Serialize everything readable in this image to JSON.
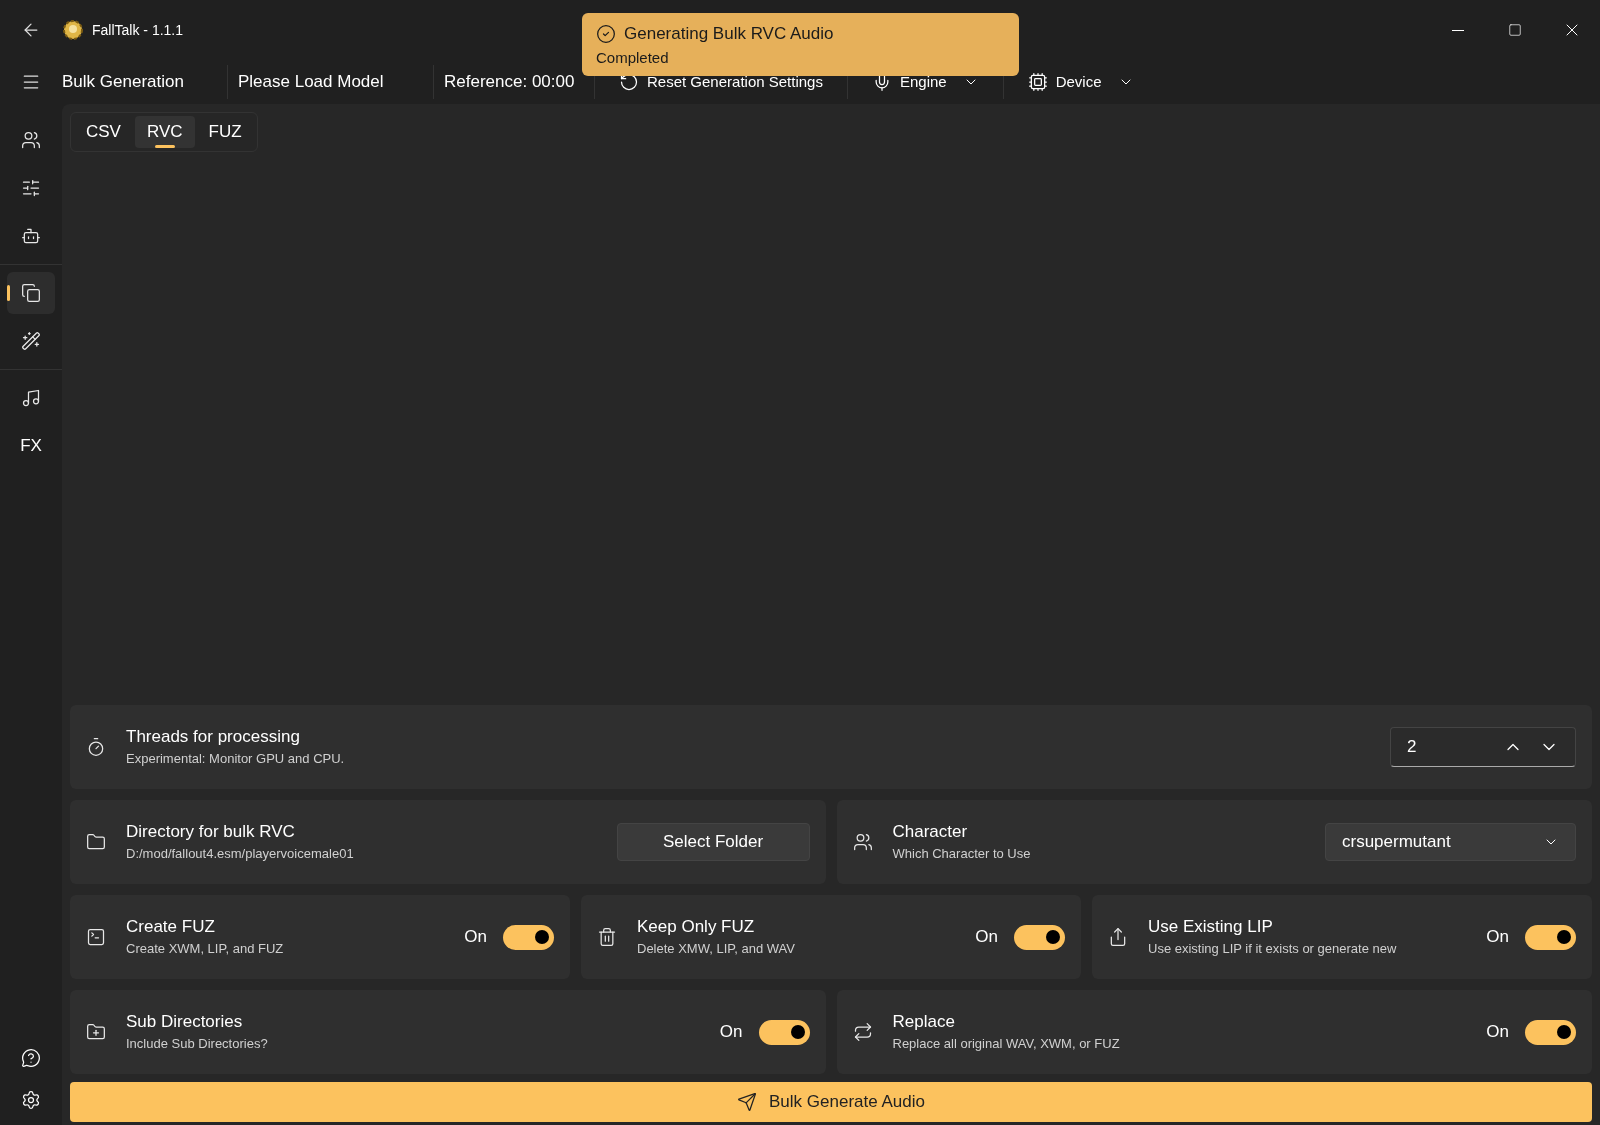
{
  "window": {
    "title": "FallTalk - 1.1.1"
  },
  "toast": {
    "title": "Generating Bulk RVC Audio",
    "message": "Completed"
  },
  "toolbar": {
    "page_title": "Bulk Generation",
    "model": "Please Load Model",
    "reference": "Reference: 00:00",
    "reset": "Reset Generation Settings",
    "engine": "Engine",
    "device": "Device"
  },
  "sidebar": {
    "items": [
      {
        "kind": "icon",
        "selected": false
      },
      {
        "kind": "icon",
        "selected": false
      },
      {
        "kind": "icon",
        "selected": false
      },
      {
        "kind": "icon",
        "selected": true
      },
      {
        "kind": "icon",
        "selected": false
      },
      {
        "kind": "icon",
        "selected": false
      },
      {
        "kind": "text",
        "label": "FX",
        "selected": false
      }
    ]
  },
  "tabs": [
    {
      "label": "CSV",
      "selected": false
    },
    {
      "label": "RVC",
      "selected": true
    },
    {
      "label": "FUZ",
      "selected": false
    }
  ],
  "threads": {
    "title": "Threads for processing",
    "subtitle": "Experimental: Monitor GPU and CPU.",
    "value": "2"
  },
  "directory": {
    "title": "Directory for bulk RVC",
    "subtitle": "D:/mod/fallout4.esm/playervoicemale01",
    "button": "Select Folder"
  },
  "character": {
    "title": "Character",
    "subtitle": "Which Character to Use",
    "value": "crsupermutant"
  },
  "toggles_row_1": [
    {
      "title": "Create FUZ",
      "subtitle": "Create XWM, LIP, and FUZ",
      "state_label": "On",
      "on": true
    },
    {
      "title": "Keep Only FUZ",
      "subtitle": "Delete XMW, LIP, and WAV",
      "state_label": "On",
      "on": true
    },
    {
      "title": "Use Existing LIP",
      "subtitle": "Use existing LIP if it exists or generate new",
      "state_label": "On",
      "on": true
    }
  ],
  "toggles_row_2": [
    {
      "title": "Sub Directories",
      "subtitle": "Include Sub Directories?",
      "state_label": "On",
      "on": true
    },
    {
      "title": "Replace",
      "subtitle": "Replace all original WAV, XWM, or FUZ",
      "state_label": "On",
      "on": true
    }
  ],
  "generate_button": "Bulk Generate Audio"
}
